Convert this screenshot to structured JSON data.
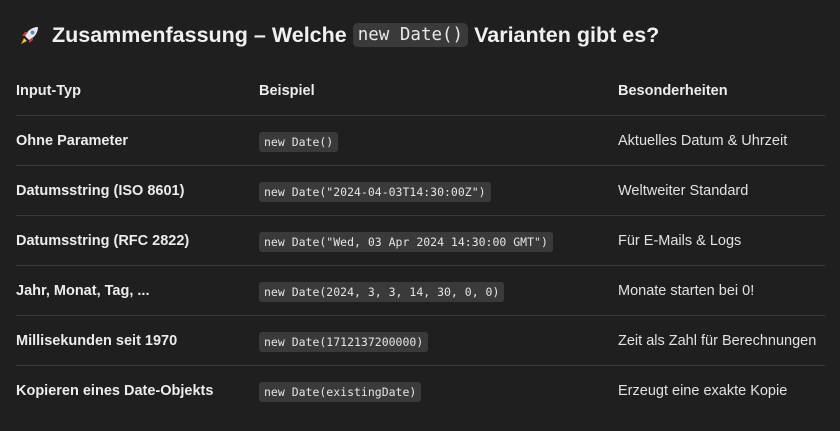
{
  "heading": {
    "icon": "rocket-icon",
    "text_before": "Zusammenfassung – Welche",
    "code": "new Date()",
    "text_after": "Varianten gibt es?"
  },
  "table": {
    "headers": [
      "Input-Typ",
      "Beispiel",
      "Besonderheiten"
    ],
    "rows": [
      {
        "input": "Ohne Parameter",
        "example": "new Date()",
        "note": "Aktuelles Datum & Uhrzeit"
      },
      {
        "input": "Datumsstring (ISO 8601)",
        "example": "new Date(\"2024-04-03T14:30:00Z\")",
        "note": "Weltweiter Standard"
      },
      {
        "input": "Datumsstring (RFC 2822)",
        "example": "new Date(\"Wed, 03 Apr 2024 14:30:00 GMT\")",
        "note": "Für E-Mails & Logs"
      },
      {
        "input": "Jahr, Monat, Tag, ...",
        "example": "new Date(2024, 3, 3, 14, 30, 0, 0)",
        "note": "Monate starten bei 0!"
      },
      {
        "input": "Millisekunden seit 1970",
        "example": "new Date(1712137200000)",
        "note": "Zeit als Zahl für Berechnungen"
      },
      {
        "input": "Kopieren eines Date-Objekts",
        "example": "new Date(existingDate)",
        "note": "Erzeugt eine exakte Kopie"
      }
    ]
  }
}
